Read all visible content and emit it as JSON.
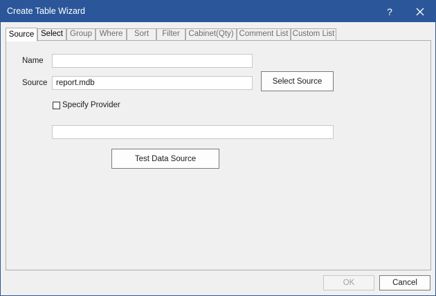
{
  "window": {
    "title": "Create Table Wizard",
    "help_label": "?",
    "accent_color": "#2b579a"
  },
  "tabs": [
    {
      "label": "Source",
      "state": "active"
    },
    {
      "label": "Select",
      "state": "enabled"
    },
    {
      "label": "Group",
      "state": "disabled"
    },
    {
      "label": "Where",
      "state": "disabled"
    },
    {
      "label": "Sort",
      "state": "disabled"
    },
    {
      "label": "Filter",
      "state": "disabled"
    },
    {
      "label": "Cabinet(Qty)",
      "state": "disabled"
    },
    {
      "label": "Comment List",
      "state": "disabled"
    },
    {
      "label": "Custom List",
      "state": "disabled"
    }
  ],
  "form": {
    "name_label": "Name",
    "name_value": "",
    "source_label": "Source",
    "source_value": "report.mdb",
    "select_source_label": "Select Source",
    "specify_provider_label": "Specify Provider",
    "specify_provider_checked": false,
    "provider_value": "",
    "test_data_source_label": "Test Data Source"
  },
  "footer": {
    "ok_label": "OK",
    "ok_enabled": false,
    "cancel_label": "Cancel"
  }
}
